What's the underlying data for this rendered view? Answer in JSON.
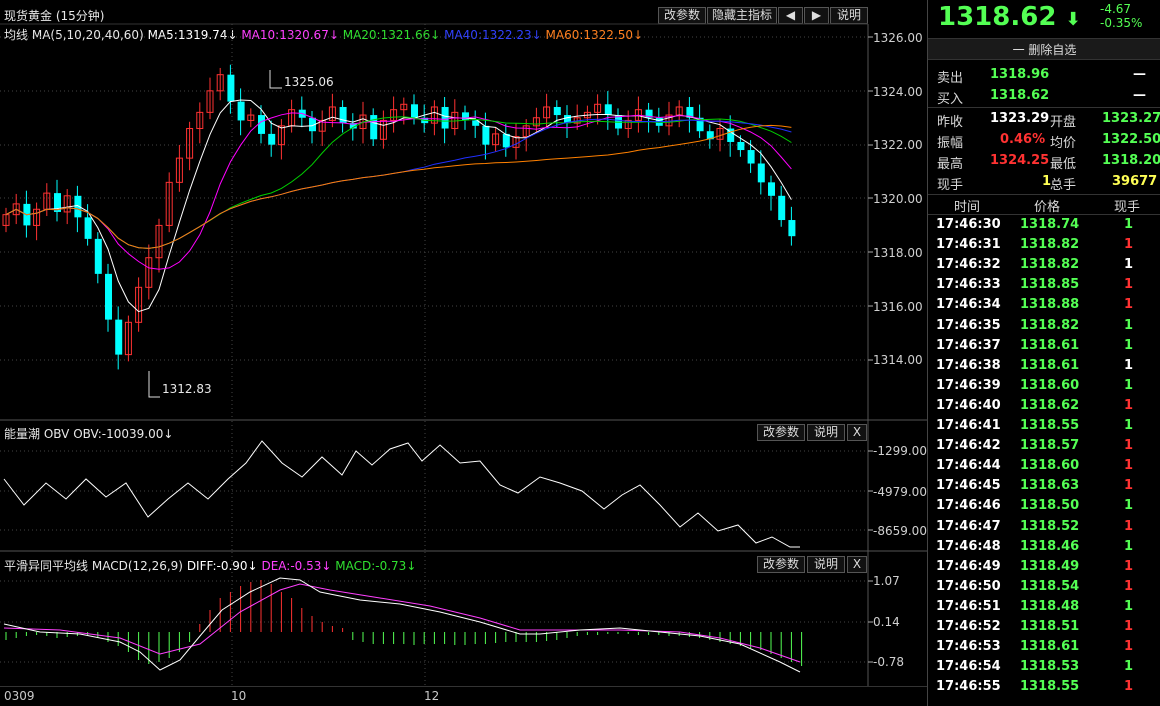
{
  "main_chart": {
    "title": "现货黄金 (15分钟)",
    "buttons": {
      "params": "改参数",
      "hide_indicator": "隐藏主指标",
      "prev": "◀",
      "next": "▶",
      "explain": "说明"
    },
    "ma_legend": {
      "name": "均线",
      "params": "MA(5,10,20,40,60)",
      "ma5": "MA5:1319.74↓",
      "ma10": "MA10:1320.67↓",
      "ma20": "MA20:1321.66↓",
      "ma40": "MA40:1322.23↓",
      "ma60": "MA60:1322.50↓"
    },
    "y_ticks": [
      "1326.00",
      "1324.00",
      "1322.00",
      "1320.00",
      "1318.00",
      "1316.00",
      "1314.00"
    ],
    "high_label": "1325.06",
    "low_label": "1312.83",
    "colors": {
      "up": "#ff3232",
      "down": "#00ffff",
      "ma5": "#ffffff",
      "ma10": "#ff00ff",
      "ma20": "#00d000",
      "ma40": "#2030ff",
      "ma60": "#ff8000"
    }
  },
  "obv_panel": {
    "legend_name": "能量潮",
    "legend_indicator": "OBV",
    "legend_value": "OBV:-10039.00↓",
    "buttons": {
      "params": "改参数",
      "explain": "说明",
      "close": "X"
    },
    "y_ticks": [
      "-1299.00",
      "-4979.00",
      "-8659.00"
    ]
  },
  "macd_panel": {
    "legend_name": "平滑异同平均线",
    "legend_params": "MACD(12,26,9)",
    "diff": "DIFF:-0.90↓",
    "dea": "DEA:-0.53↓",
    "macd": "MACD:-0.73↓",
    "buttons": {
      "params": "改参数",
      "explain": "说明",
      "close": "X"
    },
    "y_ticks": [
      "1.07",
      "0.14",
      "-0.78"
    ]
  },
  "x_axis": {
    "labels": [
      "0309",
      "10",
      "12"
    ]
  },
  "quote": {
    "price": "1318.62",
    "arrow": "⬇",
    "change": "-4.67",
    "change_pct": "-0.35%",
    "remove_watch": "一 删除自选",
    "sell_label": "卖出",
    "sell_value": "1318.96",
    "sell_vol": "—",
    "buy_label": "买入",
    "buy_value": "1318.62",
    "buy_vol": "—",
    "prev_close_label": "昨收",
    "prev_close": "1323.29",
    "open_label": "开盘",
    "open": "1323.27",
    "amplitude_label": "振幅",
    "amplitude": "0.46%",
    "avg_label": "均价",
    "avg": "1322.50",
    "high_label": "最高",
    "high": "1324.25",
    "low_label": "最低",
    "low": "1318.20",
    "cur_vol_label": "现手",
    "cur_vol": "1",
    "total_vol_label": "总手",
    "total_vol": "39677"
  },
  "ticks": {
    "headers": [
      "时间",
      "价格",
      "现手"
    ],
    "rows": [
      [
        "17:46:30",
        "1318.74",
        "1",
        "dn"
      ],
      [
        "17:46:31",
        "1318.82",
        "1",
        "up"
      ],
      [
        "17:46:32",
        "1318.82",
        "1",
        "wh"
      ],
      [
        "17:46:33",
        "1318.85",
        "1",
        "up"
      ],
      [
        "17:46:34",
        "1318.88",
        "1",
        "up"
      ],
      [
        "17:46:35",
        "1318.82",
        "1",
        "dn"
      ],
      [
        "17:46:37",
        "1318.61",
        "1",
        "dn"
      ],
      [
        "17:46:38",
        "1318.61",
        "1",
        "wh"
      ],
      [
        "17:46:39",
        "1318.60",
        "1",
        "dn"
      ],
      [
        "17:46:40",
        "1318.62",
        "1",
        "up"
      ],
      [
        "17:46:41",
        "1318.55",
        "1",
        "dn"
      ],
      [
        "17:46:42",
        "1318.57",
        "1",
        "up"
      ],
      [
        "17:46:44",
        "1318.60",
        "1",
        "up"
      ],
      [
        "17:46:45",
        "1318.63",
        "1",
        "up"
      ],
      [
        "17:46:46",
        "1318.50",
        "1",
        "dn"
      ],
      [
        "17:46:47",
        "1318.52",
        "1",
        "up"
      ],
      [
        "17:46:48",
        "1318.46",
        "1",
        "dn"
      ],
      [
        "17:46:49",
        "1318.49",
        "1",
        "up"
      ],
      [
        "17:46:50",
        "1318.54",
        "1",
        "up"
      ],
      [
        "17:46:51",
        "1318.48",
        "1",
        "dn"
      ],
      [
        "17:46:52",
        "1318.51",
        "1",
        "up"
      ],
      [
        "17:46:53",
        "1318.61",
        "1",
        "up"
      ],
      [
        "17:46:54",
        "1318.53",
        "1",
        "dn"
      ],
      [
        "17:46:55",
        "1318.55",
        "1",
        "up"
      ]
    ]
  }
}
